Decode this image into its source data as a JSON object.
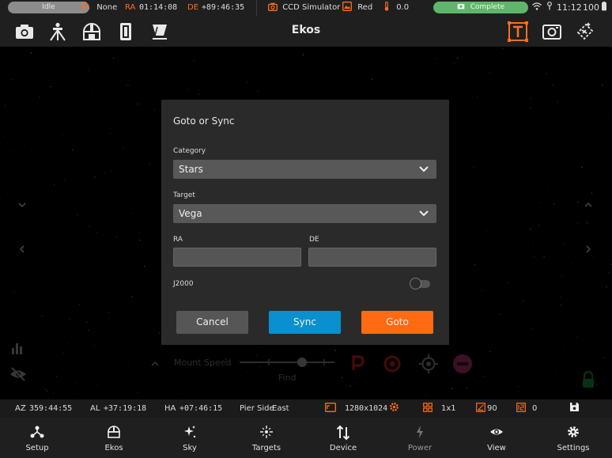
{
  "status_bar": {
    "state": "Idle",
    "guide_icon": "guide-icon",
    "guide_value": "None",
    "ra_label": "RA",
    "ra_value": "01:14:08",
    "de_label": "DE",
    "de_value": "+89:46:35",
    "camera_name": "CCD Simulator",
    "filter": "Red",
    "temperature": "0.0",
    "capture_status": "Complete",
    "time": "11:12",
    "battery": "100",
    "accent_color": "#ff6e1c",
    "complete_color": "#5fb56b"
  },
  "toolbar": {
    "title": "Ekos",
    "icons": [
      "camera-icon",
      "telescope-mount-icon",
      "observatory-dome-icon",
      "filter-wheel-icon",
      "flat-panel-icon",
      "text-overlay-icon",
      "capture-frame-icon",
      "solve-icon"
    ]
  },
  "mount": {
    "speed_label": "Mount Speed",
    "find_label": "Find"
  },
  "dialog": {
    "title": "Goto or Sync",
    "category_label": "Category",
    "category_value": "Stars",
    "target_label": "Target",
    "target_value": "Vega",
    "ra_label": "RA",
    "ra_value": "",
    "de_label": "DE",
    "de_value": "",
    "j2000_label": "J2000",
    "j2000_on": false,
    "cancel_label": "Cancel",
    "sync_label": "Sync",
    "goto_label": "Goto",
    "sync_color": "#0a8fcf",
    "goto_color": "#ff6a12"
  },
  "info_bar": {
    "az_label": "AZ",
    "az_value": "359:44:55",
    "al_label": "AL",
    "al_value": "+37:19:18",
    "ha_label": "HA",
    "ha_value": "+07:46:15",
    "pier_label": "Pier Side",
    "pier_value": "East",
    "resolution": "1280x1024",
    "binning": "1x1",
    "angle": "90",
    "count": "0"
  },
  "bottom_nav": [
    {
      "label": "Setup",
      "icon": "setup-icon"
    },
    {
      "label": "Ekos",
      "icon": "ekos-icon"
    },
    {
      "label": "Sky",
      "icon": "sky-icon"
    },
    {
      "label": "Targets",
      "icon": "targets-icon"
    },
    {
      "label": "Device",
      "icon": "device-icon"
    },
    {
      "label": "Power",
      "icon": "power-icon"
    },
    {
      "label": "View",
      "icon": "view-icon"
    },
    {
      "label": "Settings",
      "icon": "settings-icon"
    }
  ]
}
